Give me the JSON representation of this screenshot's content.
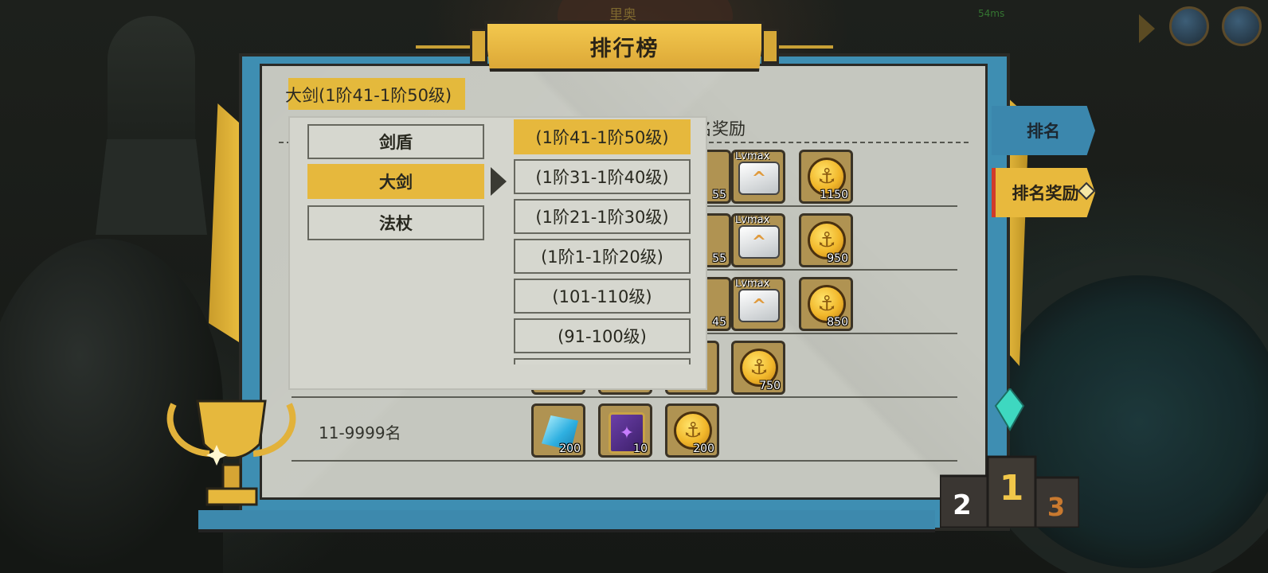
{
  "status": {
    "top_text": "里奥",
    "ping": "54ms"
  },
  "window": {
    "title": "排行榜"
  },
  "current_selection": "大剑(1阶41-1阶50级)",
  "table": {
    "header_reward": "名奖励",
    "rows": [
      {
        "items": [
          {
            "qty": "55"
          },
          {
            "top": "Lvmax",
            "icon": "scroll-icon"
          },
          {
            "icon": "gold-coin-icon",
            "qty": "1150"
          }
        ]
      },
      {
        "items": [
          {
            "qty": "55"
          },
          {
            "top": "Lvmax",
            "icon": "scroll-icon"
          },
          {
            "icon": "gold-coin-icon",
            "qty": "950"
          }
        ]
      },
      {
        "items": [
          {
            "qty": "45"
          },
          {
            "top": "Lvmax",
            "icon": "scroll-icon"
          },
          {
            "icon": "gold-coin-icon",
            "qty": "850"
          }
        ]
      },
      {
        "items": [
          {
            "icon": "gold-coin-icon",
            "qty": "750"
          }
        ]
      },
      {
        "rank": "11-9999名",
        "items": [
          {
            "icon": "crystal-icon",
            "qty": "200"
          },
          {
            "icon": "book-icon",
            "qty": "10"
          },
          {
            "icon": "gold-coin-icon",
            "qty": "200"
          }
        ]
      }
    ]
  },
  "dropdown": {
    "categories": [
      "剑盾",
      "大剑",
      "法杖"
    ],
    "selected_category": "大剑",
    "levels": [
      "(1阶41-1阶50级)",
      "(1阶31-1阶40级)",
      "(1阶21-1阶30级)",
      "(1阶1-1阶20级)",
      "(101-110级)",
      "(91-100级)"
    ],
    "selected_level": "(1阶41-1阶50级)"
  },
  "tabs": [
    "排名",
    "排名奖励"
  ],
  "active_tab": "排名奖励",
  "podium": [
    "2",
    "1",
    "3"
  ],
  "colors": {
    "accent_gold": "#e6b83d",
    "frame_blue": "#3e8eb2",
    "panel_grey": "#c5c7bf",
    "tab_marker_red": "#d03b2b"
  }
}
